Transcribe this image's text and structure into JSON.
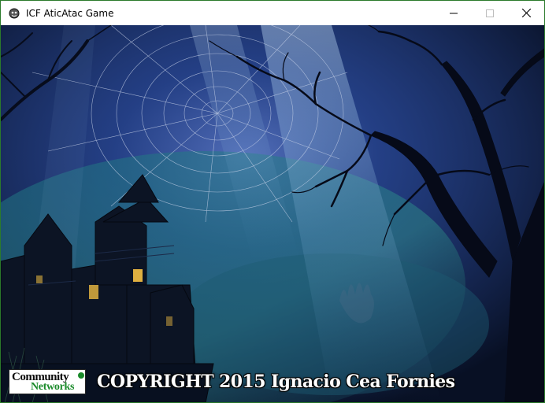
{
  "window": {
    "title": "ICF AticAtac Game",
    "icon": "game-app-icon",
    "controls": {
      "minimize_icon": "minimize-icon",
      "maximize_icon": "maximize-icon",
      "close_icon": "close-icon"
    }
  },
  "splash": {
    "background_icon": "haunted-house-cobweb-scene",
    "logo": {
      "line1": "Community",
      "line2": "Networks"
    },
    "copyright": "COPYRIGHT 2015 Ignacio Cea Fornies"
  },
  "colors": {
    "sky_dark": "#0b1330",
    "sky_mid": "#1b3c6e",
    "mist": "#2f7f86",
    "logo_green": "#1a8a2a"
  }
}
